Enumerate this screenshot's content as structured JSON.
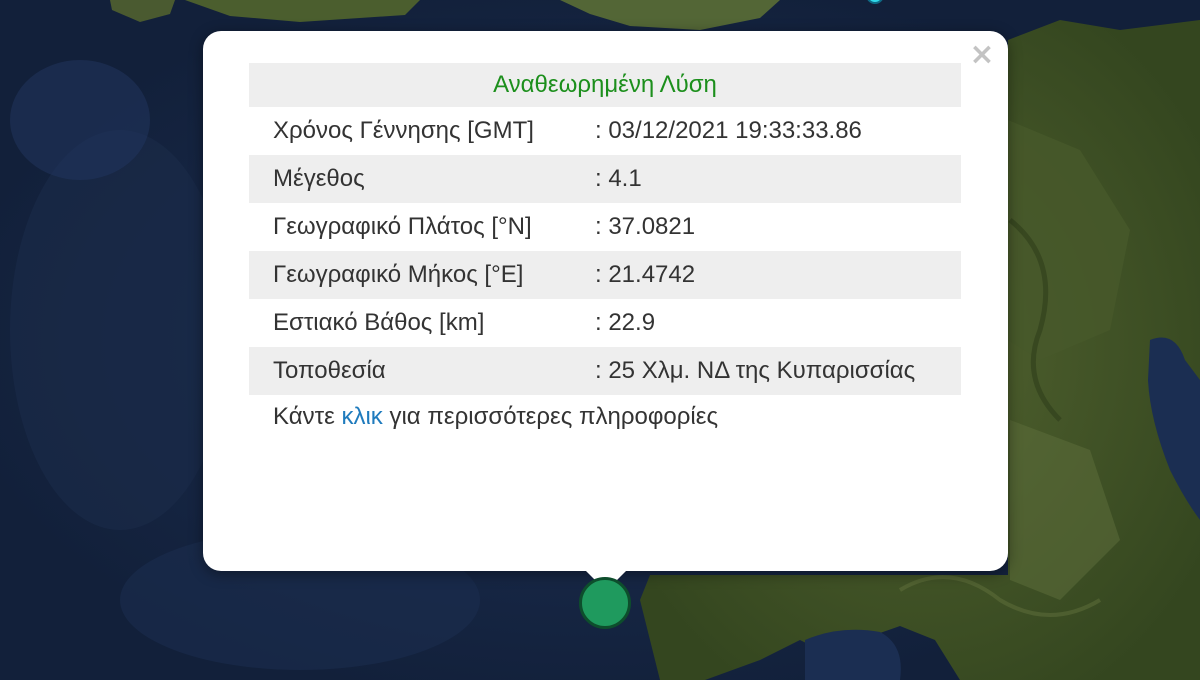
{
  "popup": {
    "title": "Αναθεωρημένη Λύση",
    "close_glyph": "×",
    "rows": [
      {
        "label": "Χρόνος Γέννησης [GMT]",
        "value": ": 03/12/2021 19:33:33.86"
      },
      {
        "label": "Μέγεθος",
        "value": ": 4.1"
      },
      {
        "label": "Γεωγραφικό Πλάτος [°N]",
        "value": ": 37.0821"
      },
      {
        "label": "Γεωγραφικό Μήκος [°E]",
        "value": ": 21.4742"
      },
      {
        "label": "Εστιακό Βάθος [km]",
        "value": ": 22.9"
      },
      {
        "label": "Τοποθεσία",
        "value": ": 25 Χλμ. ΝΔ της Κυπαρισσίας"
      }
    ],
    "footer": {
      "before": "Κάντε ",
      "link": "κλικ",
      "after": " για περισσότερες πληροφορίες"
    }
  },
  "map": {
    "sea_color": "#14233f",
    "land_color": "#3f5228",
    "marker_color": "#1f9a5e",
    "marker_icon": "earthquake-marker",
    "secondary_marker_color": "#2fd8e8"
  }
}
